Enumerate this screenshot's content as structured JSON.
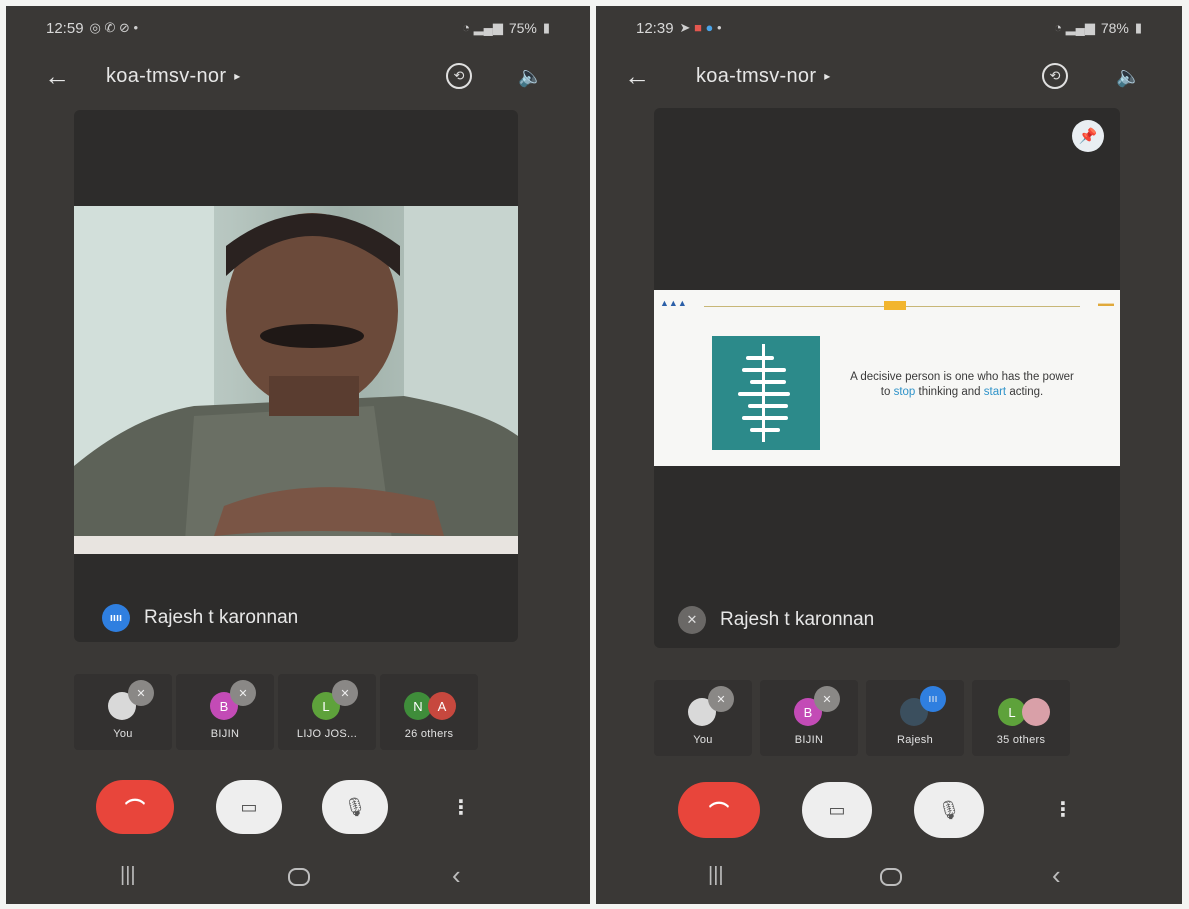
{
  "left": {
    "status": {
      "time": "12:59",
      "battery": "75%"
    },
    "header": {
      "title": "koa-tmsv-nor",
      "caret": "▸"
    },
    "main_tile": {
      "name": "Rajesh t karonnan"
    },
    "participants": [
      {
        "label": "You",
        "avatar": "",
        "avatar_color": "#d9d9d9"
      },
      {
        "label": "BIJIN",
        "avatar": "B",
        "avatar_color": "#c34bb6"
      },
      {
        "label": "LIJO JOS...",
        "avatar": "L",
        "avatar_color": "#5ea23b"
      },
      {
        "label": "26 others",
        "avatar": "N",
        "avatar2": "A",
        "avatar_color": "#3f8d3a",
        "avatar2_color": "#c7483e"
      }
    ]
  },
  "right": {
    "status": {
      "time": "12:39",
      "battery": "78%"
    },
    "header": {
      "title": "koa-tmsv-nor",
      "caret": "▸"
    },
    "slide": {
      "text_before": "A decisive person is one who has the power to ",
      "keyword1": "stop",
      "text_middle": " thinking and ",
      "keyword2": "start",
      "text_after": " acting."
    },
    "main_tile": {
      "name": "Rajesh t karonnan"
    },
    "participants": [
      {
        "label": "You",
        "avatar": "",
        "avatar_color": "#d9d9d9"
      },
      {
        "label": "BIJIN",
        "avatar": "B",
        "avatar_color": "#c34bb6"
      },
      {
        "label": "Rajesh",
        "avatar": "",
        "avatar_color": "#3b4f5e"
      },
      {
        "label": "35 others",
        "avatar": "L",
        "avatar_color": "#5ea23b"
      }
    ]
  },
  "icons": {
    "back": "←",
    "speaker": "🔈",
    "end_call": "⌒",
    "camera_off": "▭",
    "mic_off": "🎙",
    "more": "⋮",
    "nav_recents": "|||",
    "nav_back": "‹",
    "pin": "📌"
  }
}
